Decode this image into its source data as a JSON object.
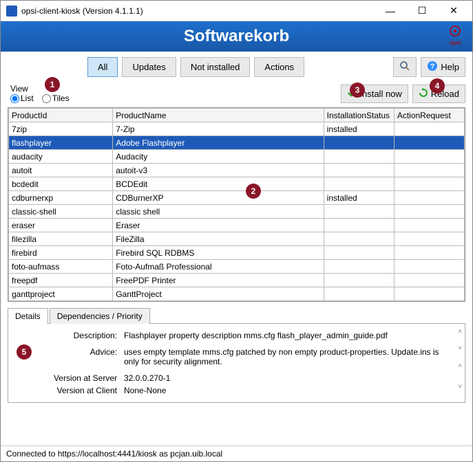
{
  "window": {
    "title": "opsi-client-kiosk (Version 4.1.1.1)"
  },
  "banner": {
    "title": "Softwarekorb",
    "logo_text": "opsi"
  },
  "toolbar": {
    "all": "All",
    "updates": "Updates",
    "notinstalled": "Not installed",
    "actions": "Actions",
    "help": "Help"
  },
  "view": {
    "label": "View",
    "list": "List",
    "tiles": "Tiles"
  },
  "actions": {
    "install_now": "Install now",
    "reload": "Reload"
  },
  "table": {
    "headers": {
      "productid": "ProductId",
      "productname": "ProductName",
      "status": "InstallationStatus",
      "request": "ActionRequest"
    },
    "rows": [
      {
        "id": "7zip",
        "name": "7-Zip",
        "status": "installed",
        "req": ""
      },
      {
        "id": "flashplayer",
        "name": "Adobe Flashplayer",
        "status": "",
        "req": "",
        "selected": true
      },
      {
        "id": "audacity",
        "name": "Audacity",
        "status": "",
        "req": ""
      },
      {
        "id": "autoit",
        "name": "autoit-v3",
        "status": "",
        "req": ""
      },
      {
        "id": "bcdedit",
        "name": "BCDEdit",
        "status": "",
        "req": ""
      },
      {
        "id": "cdburnerxp",
        "name": "CDBurnerXP",
        "status": "installed",
        "req": ""
      },
      {
        "id": "classic-shell",
        "name": "classic shell",
        "status": "",
        "req": ""
      },
      {
        "id": "eraser",
        "name": "Eraser",
        "status": "",
        "req": ""
      },
      {
        "id": "filezilla",
        "name": "FileZilla",
        "status": "",
        "req": ""
      },
      {
        "id": "firebird",
        "name": "Firebird SQL RDBMS",
        "status": "",
        "req": ""
      },
      {
        "id": "foto-aufmass",
        "name": "Foto-Aufmaß Professional",
        "status": "",
        "req": ""
      },
      {
        "id": "freepdf",
        "name": "FreePDF Printer",
        "status": "",
        "req": ""
      },
      {
        "id": "ganttproject",
        "name": "GanttProject",
        "status": "",
        "req": ""
      }
    ]
  },
  "tabs": {
    "details": "Details",
    "deps": "Dependencies / Priority"
  },
  "details": {
    "labels": {
      "description": "Description:",
      "advice": "Advice:",
      "vserver": "Version at Server",
      "vclient": "Version at Client"
    },
    "description": "Flashplayer property description mms.cfg flash_player_admin_guide.pdf",
    "advice": "uses empty template mms.cfg patched by non empty product-properties. Update.ins is only for security alignment.",
    "vserver": "32.0.0.270-1",
    "vclient": "None-None"
  },
  "status": "Connected to https://localhost:4441/kiosk as pcjan.uib.local",
  "annotations": {
    "a1": "1",
    "a2": "2",
    "a3": "3",
    "a4": "4",
    "a5": "5"
  }
}
